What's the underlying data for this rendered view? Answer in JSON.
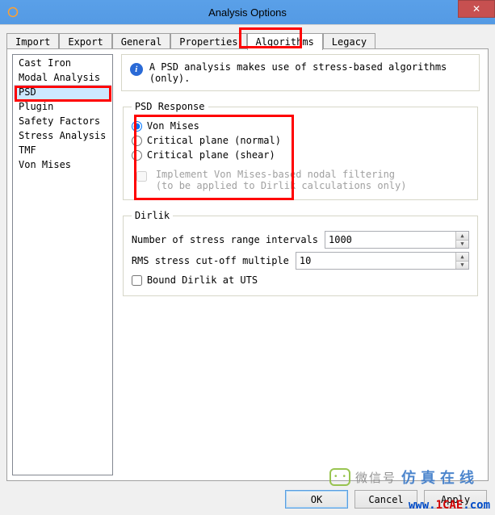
{
  "window": {
    "title": "Analysis Options"
  },
  "tabs": {
    "items": [
      {
        "label": "Import"
      },
      {
        "label": "Export"
      },
      {
        "label": "General"
      },
      {
        "label": "Properties"
      },
      {
        "label": "Algorithms"
      },
      {
        "label": "Legacy"
      }
    ],
    "selected_index": 4
  },
  "sidebar": {
    "items": [
      {
        "label": "Cast Iron"
      },
      {
        "label": "Modal Analysis"
      },
      {
        "label": "PSD"
      },
      {
        "label": "Plugin"
      },
      {
        "label": "Safety Factors"
      },
      {
        "label": "Stress Analysis"
      },
      {
        "label": "TMF"
      },
      {
        "label": "Von Mises"
      }
    ],
    "selected_index": 2
  },
  "info": {
    "text": "A PSD analysis makes use of stress-based algorithms (only)."
  },
  "psd_response": {
    "legend": "PSD Response",
    "options": [
      {
        "label": "Von Mises",
        "checked": true
      },
      {
        "label": "Critical plane (normal)",
        "checked": false
      },
      {
        "label": "Critical plane (shear)",
        "checked": false
      }
    ],
    "nodal_filtering": {
      "line1": "Implement Von Mises-based nodal filtering",
      "line2": "(to be applied to Dirlik calculations only)",
      "checked": false,
      "enabled": false
    }
  },
  "dirlik": {
    "legend": "Dirlik",
    "intervals": {
      "label": "Number of stress range intervals",
      "value": "1000"
    },
    "rms_cutoff": {
      "label": "RMS stress cut-off multiple",
      "value": "10"
    },
    "bound_uts": {
      "label": "Bound Dirlik at UTS",
      "checked": false
    }
  },
  "buttons": {
    "ok": "OK",
    "cancel": "Cancel",
    "apply": "Apply"
  },
  "watermark": {
    "wx_label": "微信号",
    "brand": "仿真在线",
    "url_a": "www.",
    "url_b": "1CAE",
    "url_c": ".com"
  }
}
